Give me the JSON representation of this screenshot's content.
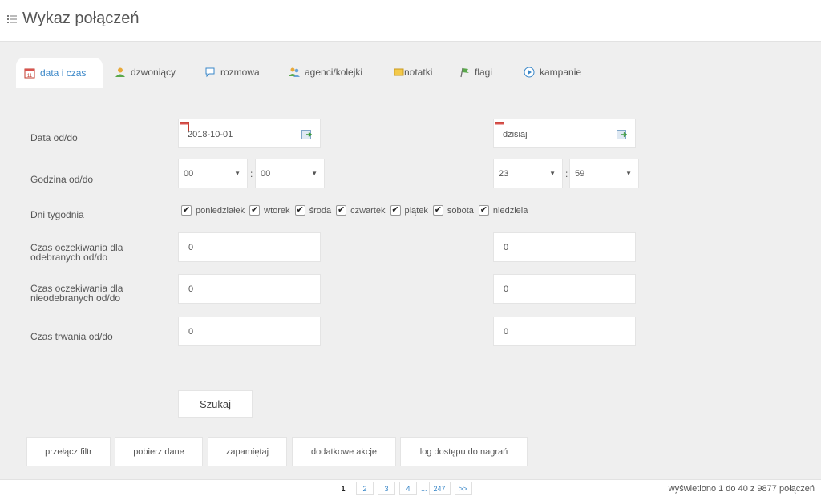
{
  "header": {
    "title": "Wykaz połączeń",
    "icon": "list-icon"
  },
  "tabs": [
    {
      "label": "data i czas",
      "icon": "calendar-icon",
      "active": true
    },
    {
      "label": "dzwoniący",
      "icon": "user-icon"
    },
    {
      "label": "rozmowa",
      "icon": "speech-bubble-icon"
    },
    {
      "label": "agenci/kolejki",
      "icon": "users-icon"
    },
    {
      "label": "notatki",
      "icon": "note-icon"
    },
    {
      "label": "flagi",
      "icon": "flag-icon"
    },
    {
      "label": "kampanie",
      "icon": "play-circle-icon"
    }
  ],
  "form": {
    "date_label": "Data od/do",
    "date_from": "2018-10-01",
    "date_to": "dzisiaj",
    "hour_label": "Godzina od/do",
    "hour_from_h": "00",
    "hour_from_m": "00",
    "hour_to_h": "23",
    "hour_to_m": "59",
    "colon": ":",
    "days_label": "Dni tygodnia",
    "days": [
      {
        "label": "poniedziałek",
        "checked": true
      },
      {
        "label": "wtorek",
        "checked": true
      },
      {
        "label": "środa",
        "checked": true
      },
      {
        "label": "czwartek",
        "checked": true
      },
      {
        "label": "piątek",
        "checked": true
      },
      {
        "label": "sobota",
        "checked": true
      },
      {
        "label": "niedziela",
        "checked": true
      }
    ],
    "wait_answered_label_1": "Czas oczekiwania dla",
    "wait_answered_label_2": "odebranych od/do",
    "wait_answered_from": "0",
    "wait_answered_to": "0",
    "wait_unanswered_label_1": "Czas oczekiwania dla",
    "wait_unanswered_label_2": "nieodebranych od/do",
    "wait_unanswered_from": "0",
    "wait_unanswered_to": "0",
    "duration_label": "Czas trwania od/do",
    "duration_from": "0",
    "duration_to": "0",
    "search_label": "Szukaj"
  },
  "actions": {
    "toggle_filter": "przełącz filtr",
    "download": "pobierz dane",
    "remember": "zapamiętaj",
    "more": "dodatkowe akcje",
    "recording_log": "log dostępu do nagrań"
  },
  "pagination": {
    "pages": [
      "1",
      "2",
      "3",
      "4"
    ],
    "current": "1",
    "ellipsis": "...",
    "last": "247",
    "next": ">>",
    "summary": "wyświetlono 1 do 40 z 9877 połączeń"
  },
  "colors": {
    "accent": "#3a87c8",
    "panel": "#efefef"
  }
}
